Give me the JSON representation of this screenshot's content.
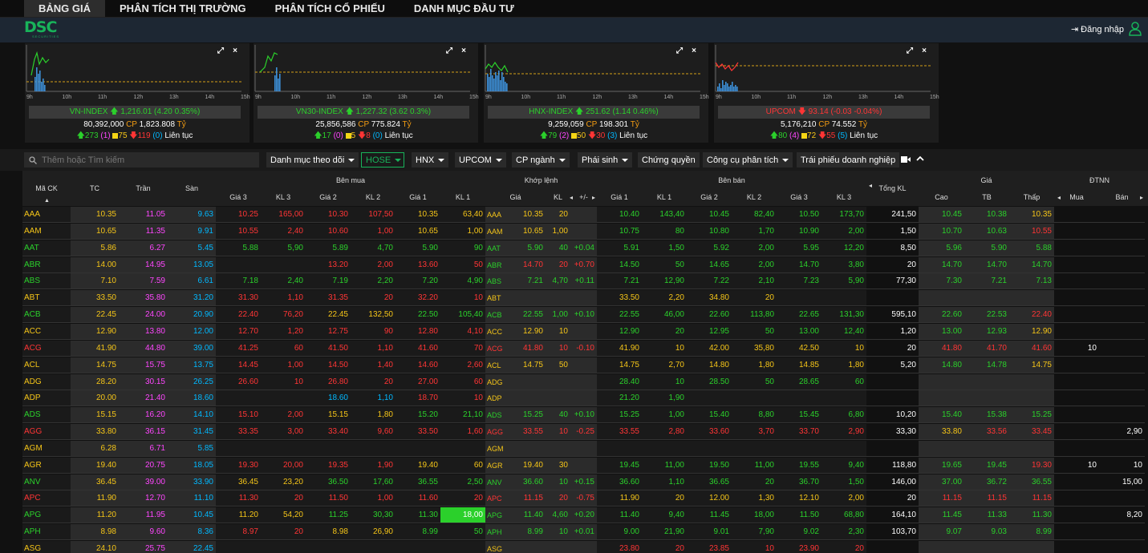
{
  "nav": {
    "tabs": [
      "BẢNG GIÁ",
      "PHÂN TÍCH THỊ TRƯỜNG",
      "PHÂN TÍCH CỔ PHIẾU",
      "DANH MỤC ĐẦU TƯ"
    ],
    "active": 0
  },
  "header": {
    "logo": "DSC",
    "logo_sub": "SECURITIES",
    "login_label": "Đăng nhập"
  },
  "indices": [
    {
      "name": "VN-INDEX",
      "value": "1,216.01",
      "change": "(4.20 0.35%)",
      "dir": "up",
      "volume": "80,392,000",
      "cp_label": "CP",
      "value_traded": "1,823.808",
      "unit": "Tỷ",
      "adv": "273",
      "ceil": "(1)",
      "unch": "75",
      "dec": "119",
      "floor": "(0)",
      "session": "Liên tục"
    },
    {
      "name": "VN30-INDEX",
      "value": "1,227.32",
      "change": "(3.62 0.3%)",
      "dir": "up",
      "volume": "25,856,586",
      "cp_label": "CP",
      "value_traded": "775.824",
      "unit": "Tỷ",
      "adv": "17",
      "ceil": "(0)",
      "unch": "5",
      "dec": "8",
      "floor": "(0)",
      "session": "Liên tục"
    },
    {
      "name": "HNX-INDEX",
      "value": "251.62",
      "change": "(1.14 0.46%)",
      "dir": "up",
      "volume": "9,259,059",
      "cp_label": "CP",
      "value_traded": "198.301",
      "unit": "Tỷ",
      "adv": "79",
      "ceil": "(2)",
      "unch": "50",
      "dec": "30",
      "floor": "(3)",
      "session": "Liên tục"
    },
    {
      "name": "UPCOM",
      "value": "93.14",
      "change": "(-0.03 -0.04%)",
      "dir": "down",
      "volume": "5,176,210",
      "cp_label": "CP",
      "value_traded": "74.552",
      "unit": "Tỷ",
      "adv": "80",
      "ceil": "(4)",
      "unch": "72",
      "dec": "55",
      "floor": "(5)",
      "session": "Liên tục"
    }
  ],
  "chart_ticks": [
    "9h",
    "10h",
    "11h",
    "12h",
    "13h",
    "14h",
    "15h"
  ],
  "filters": {
    "search_placeholder": "Thêm hoặc Tìm kiếm",
    "buttons": [
      "Danh mục theo dõi",
      "HOSE",
      "HNX",
      "UPCOM",
      "CP ngành",
      "Phái sinh",
      "Chứng quyền",
      "Công cụ phân tích",
      "Trái phiếu doanh nghiệp"
    ]
  },
  "table_headers": {
    "groups": [
      "Bên mua",
      "Khớp lệnh",
      "Bên bán",
      "Giá",
      "ĐTNN"
    ],
    "ma_ck": "Mã CK",
    "tc": "TC",
    "tran": "Trần",
    "san": "Sàn",
    "tong_kl": "Tổng KL",
    "buy": [
      "Giá 3",
      "KL 3",
      "Giá 2",
      "KL 2",
      "Giá 1",
      "KL 1"
    ],
    "match": [
      "Giá",
      "KL",
      "+/-"
    ],
    "sell": [
      "Giá 1",
      "KL 1",
      "Giá 2",
      "KL 2",
      "Giá 3",
      "KL 3"
    ],
    "price": [
      "Cao",
      "TB",
      "Thấp"
    ],
    "foreign": [
      "Mua",
      "Bán"
    ]
  },
  "rows": [
    {
      "sym": "AAA",
      "c": "y",
      "tc": "10.35",
      "tr": "11.05",
      "sa": "9.63",
      "b3": "10.25",
      "k3": "165,00",
      "b2": "10.30",
      "k2": "107,50",
      "b1": "10.35",
      "k1": "63,40",
      "cb": "y",
      "mp": "10.35",
      "mk": "20",
      "mc": "",
      "s1": "10.40",
      "s1k": "143,40",
      "s2": "10.45",
      "s2k": "82,40",
      "s3": "10.50",
      "s3k": "173,70",
      "tkl": "241,50",
      "hi": "10.45",
      "tb": "10.38",
      "lo": "10.35",
      "fb": "",
      "fs": "",
      "sc": "g",
      "hc": "g",
      "lc": "y",
      "b3c": "r",
      "b2c": "r",
      "b1c": "y"
    },
    {
      "sym": "AAM",
      "c": "y",
      "tc": "10.65",
      "tr": "11.35",
      "sa": "9.91",
      "b3": "10.55",
      "k3": "2,40",
      "b2": "10.60",
      "k2": "1,00",
      "b1": "10.65",
      "k1": "1,00",
      "cb": "y",
      "mp": "10.65",
      "mk": "1,00",
      "mc": "",
      "s1": "10.75",
      "s1k": "80",
      "s2": "10.80",
      "s2k": "1,70",
      "s3": "10.90",
      "s3k": "2,00",
      "tkl": "1,50",
      "hi": "10.70",
      "tb": "10.63",
      "lo": "10.55",
      "fb": "",
      "fs": "",
      "sc": "g",
      "hc": "g",
      "lc": "r",
      "b3c": "r",
      "b2c": "r",
      "b1c": "y"
    },
    {
      "sym": "AAT",
      "c": "g",
      "tc": "5.86",
      "tr": "6.27",
      "sa": "5.45",
      "b3": "5.88",
      "k3": "5,90",
      "b2": "5.89",
      "k2": "4,70",
      "b1": "5.90",
      "k1": "90",
      "cb": "g",
      "mp": "5.90",
      "mk": "40",
      "mc": "+0.04",
      "s1": "5.91",
      "s1k": "1,50",
      "s2": "5.92",
      "s2k": "2,00",
      "s3": "5.95",
      "s3k": "12,20",
      "tkl": "8,50",
      "hi": "5.96",
      "tb": "5.90",
      "lo": "5.88",
      "fb": "",
      "fs": "",
      "sc": "g",
      "hc": "g",
      "lc": "g",
      "b3c": "g",
      "b2c": "g",
      "b1c": "g"
    },
    {
      "sym": "ABR",
      "c": "g",
      "tc": "14.00",
      "tr": "14.95",
      "sa": "13.05",
      "b3": "",
      "k3": "",
      "b2": "13.20",
      "k2": "2,00",
      "b1": "13.60",
      "k1": "50",
      "cb": "r",
      "mp": "14.70",
      "mk": "20",
      "mc": "+0.70",
      "s1": "14.50",
      "s1k": "50",
      "s2": "14.65",
      "s2k": "2,00",
      "s3": "14.70",
      "s3k": "3,80",
      "tkl": "20",
      "hi": "14.70",
      "tb": "14.70",
      "lo": "14.70",
      "fb": "",
      "fs": "",
      "sc": "g",
      "hc": "g",
      "lc": "g",
      "b3c": "r",
      "b2c": "r",
      "b1c": "r"
    },
    {
      "sym": "ABS",
      "c": "g",
      "tc": "7.10",
      "tr": "7.59",
      "sa": "6.61",
      "b3": "7.18",
      "k3": "2,40",
      "b2": "7.19",
      "k2": "2,20",
      "b1": "7.20",
      "k1": "4,90",
      "cb": "g",
      "mp": "7.21",
      "mk": "4,70",
      "mc": "+0.11",
      "s1": "7.21",
      "s1k": "12,90",
      "s2": "7.22",
      "s2k": "2,10",
      "s3": "7.23",
      "s3k": "5,90",
      "tkl": "77,30",
      "hi": "7.30",
      "tb": "7.21",
      "lo": "7.13",
      "fb": "",
      "fs": "",
      "sc": "g",
      "hc": "g",
      "lc": "g",
      "b3c": "g",
      "b2c": "g",
      "b1c": "g"
    },
    {
      "sym": "ABT",
      "c": "y",
      "tc": "33.50",
      "tr": "35.80",
      "sa": "31.20",
      "b3": "31.30",
      "k3": "1,10",
      "b2": "31.35",
      "k2": "20",
      "b1": "32.20",
      "k1": "10",
      "cb": "y",
      "mp": "",
      "mk": "",
      "mc": "",
      "s1": "33.50",
      "s1k": "2,20",
      "s2": "34.80",
      "s2k": "20",
      "s3": "",
      "s3k": "",
      "tkl": "",
      "hi": "",
      "tb": "",
      "lo": "",
      "fb": "",
      "fs": "",
      "sc": "y",
      "hc": "g",
      "lc": "g",
      "b3c": "r",
      "b2c": "r",
      "b1c": "r"
    },
    {
      "sym": "ACB",
      "c": "g",
      "tc": "22.45",
      "tr": "24.00",
      "sa": "20.90",
      "b3": "22.40",
      "k3": "76,20",
      "b2": "22.45",
      "k2": "132,50",
      "b1": "22.50",
      "k1": "105,40",
      "cb": "g",
      "mp": "22.55",
      "mk": "1,00",
      "mc": "+0.10",
      "s1": "22.55",
      "s1k": "46,00",
      "s2": "22.60",
      "s2k": "113,80",
      "s3": "22.65",
      "s3k": "131,30",
      "tkl": "595,10",
      "hi": "22.60",
      "tb": "22.53",
      "lo": "22.40",
      "fb": "",
      "fs": "",
      "sc": "g",
      "hc": "g",
      "lc": "r",
      "b3c": "r",
      "b2c": "y",
      "b1c": "g"
    },
    {
      "sym": "ACC",
      "c": "y",
      "tc": "12.90",
      "tr": "13.80",
      "sa": "12.00",
      "b3": "12.70",
      "k3": "1,20",
      "b2": "12.75",
      "k2": "90",
      "b1": "12.80",
      "k1": "4,10",
      "cb": "y",
      "mp": "12.90",
      "mk": "10",
      "mc": "",
      "s1": "12.90",
      "s1k": "20",
      "s2": "12.95",
      "s2k": "50",
      "s3": "13.00",
      "s3k": "12,40",
      "tkl": "1,20",
      "hi": "13.00",
      "tb": "12.93",
      "lo": "12.90",
      "fb": "",
      "fs": "",
      "sc": "g",
      "hc": "g",
      "lc": "y",
      "b3c": "r",
      "b2c": "r",
      "b1c": "r"
    },
    {
      "sym": "ACG",
      "c": "r",
      "tc": "41.90",
      "tr": "44.80",
      "sa": "39.00",
      "b3": "41.25",
      "k3": "60",
      "b2": "41.50",
      "k2": "1,10",
      "b1": "41.60",
      "k1": "70",
      "cb": "r",
      "mp": "41.80",
      "mk": "10",
      "mc": "-0.10",
      "s1": "41.90",
      "s1k": "10",
      "s2": "42.00",
      "s2k": "35,80",
      "s3": "42.50",
      "s3k": "10",
      "tkl": "20",
      "hi": "41.80",
      "tb": "41.70",
      "lo": "41.60",
      "fb": "10",
      "fs": "",
      "sc": "y",
      "hc": "r",
      "lc": "r",
      "b3c": "r",
      "b2c": "r",
      "b1c": "r"
    },
    {
      "sym": "ACL",
      "c": "y",
      "tc": "14.75",
      "tr": "15.75",
      "sa": "13.75",
      "b3": "14.45",
      "k3": "1,00",
      "b2": "14.50",
      "k2": "1,40",
      "b1": "14.60",
      "k1": "2,60",
      "cb": "y",
      "mp": "14.75",
      "mk": "50",
      "mc": "",
      "s1": "14.75",
      "s1k": "2,70",
      "s2": "14.80",
      "s2k": "1,80",
      "s3": "14.85",
      "s3k": "1,80",
      "tkl": "5,20",
      "hi": "14.80",
      "tb": "14.78",
      "lo": "14.75",
      "fb": "",
      "fs": "",
      "sc": "y",
      "hc": "g",
      "lc": "y",
      "b3c": "r",
      "b2c": "r",
      "b1c": "r"
    },
    {
      "sym": "ADG",
      "c": "y",
      "tc": "28.20",
      "tr": "30.15",
      "sa": "26.25",
      "b3": "26.60",
      "k3": "10",
      "b2": "26.80",
      "k2": "20",
      "b1": "27.00",
      "k1": "60",
      "cb": "y",
      "mp": "",
      "mk": "",
      "mc": "",
      "s1": "28.40",
      "s1k": "10",
      "s2": "28.50",
      "s2k": "50",
      "s3": "28.65",
      "s3k": "60",
      "tkl": "",
      "hi": "",
      "tb": "",
      "lo": "",
      "fb": "",
      "fs": "",
      "sc": "g",
      "hc": "g",
      "lc": "g",
      "b3c": "r",
      "b2c": "r",
      "b1c": "r"
    },
    {
      "sym": "ADP",
      "c": "y",
      "tc": "20.00",
      "tr": "21.40",
      "sa": "18.60",
      "b3": "",
      "k3": "",
      "b2": "18.60",
      "k2": "1,10",
      "b1": "18.70",
      "k1": "10",
      "cb": "y",
      "mp": "",
      "mk": "",
      "mc": "",
      "s1": "21.20",
      "s1k": "1,90",
      "s2": "",
      "s2k": "",
      "s3": "",
      "s3k": "",
      "tkl": "",
      "hi": "",
      "tb": "",
      "lo": "",
      "fb": "",
      "fs": "",
      "sc": "g",
      "hc": "g",
      "lc": "g",
      "b3c": "r",
      "b2c": "c",
      "b1c": "r"
    },
    {
      "sym": "ADS",
      "c": "g",
      "tc": "15.15",
      "tr": "16.20",
      "sa": "14.10",
      "b3": "15.10",
      "k3": "2,00",
      "b2": "15.15",
      "k2": "1,80",
      "b1": "15.20",
      "k1": "21,10",
      "cb": "g",
      "mp": "15.25",
      "mk": "40",
      "mc": "+0.10",
      "s1": "15.25",
      "s1k": "1,00",
      "s2": "15.40",
      "s2k": "8,80",
      "s3": "15.45",
      "s3k": "6,80",
      "tkl": "10,20",
      "hi": "15.40",
      "tb": "15.38",
      "lo": "15.25",
      "fb": "",
      "fs": "",
      "sc": "g",
      "hc": "g",
      "lc": "g",
      "b3c": "r",
      "b2c": "y",
      "b1c": "g"
    },
    {
      "sym": "AGG",
      "c": "r",
      "tc": "33.80",
      "tr": "36.15",
      "sa": "31.45",
      "b3": "33.35",
      "k3": "3,00",
      "b2": "33.40",
      "k2": "9,60",
      "b1": "33.50",
      "k1": "1,60",
      "cb": "r",
      "mp": "33.55",
      "mk": "10",
      "mc": "-0.25",
      "s1": "33.55",
      "s1k": "2,80",
      "s2": "33.60",
      "s2k": "3,70",
      "s3": "33.70",
      "s3k": "2,90",
      "tkl": "33,30",
      "hi": "33.80",
      "tb": "33.56",
      "lo": "33.45",
      "fb": "",
      "fs": "2,90",
      "sc": "r",
      "hc": "y",
      "lc": "r",
      "b3c": "r",
      "b2c": "r",
      "b1c": "r"
    },
    {
      "sym": "AGM",
      "c": "y",
      "tc": "6.28",
      "tr": "6.71",
      "sa": "5.85",
      "b3": "",
      "k3": "",
      "b2": "",
      "k2": "",
      "b1": "",
      "k1": "",
      "cb": "y",
      "mp": "",
      "mk": "",
      "mc": "",
      "s1": "",
      "s1k": "",
      "s2": "",
      "s2k": "",
      "s3": "",
      "s3k": "",
      "tkl": "",
      "hi": "",
      "tb": "",
      "lo": "",
      "fb": "",
      "fs": "",
      "sc": "g",
      "hc": "g",
      "lc": "g",
      "b3c": "r",
      "b2c": "r",
      "b1c": "r"
    },
    {
      "sym": "AGR",
      "c": "y",
      "tc": "19.40",
      "tr": "20.75",
      "sa": "18.05",
      "b3": "19.30",
      "k3": "20,00",
      "b2": "19.35",
      "k2": "1,90",
      "b1": "19.40",
      "k1": "60",
      "cb": "y",
      "mp": "19.40",
      "mk": "30",
      "mc": "",
      "s1": "19.45",
      "s1k": "11,00",
      "s2": "19.50",
      "s2k": "11,00",
      "s3": "19.55",
      "s3k": "9,40",
      "tkl": "118,80",
      "hi": "19.65",
      "tb": "19.45",
      "lo": "19.30",
      "fb": "10",
      "fs": "10",
      "sc": "g",
      "hc": "g",
      "lc": "r",
      "b3c": "r",
      "b2c": "r",
      "b1c": "y"
    },
    {
      "sym": "ANV",
      "c": "g",
      "tc": "36.45",
      "tr": "39.00",
      "sa": "33.90",
      "b3": "36.45",
      "k3": "23,20",
      "b2": "36.50",
      "k2": "17,60",
      "b1": "36.55",
      "k1": "2,50",
      "cb": "g",
      "mp": "36.60",
      "mk": "10",
      "mc": "+0.15",
      "s1": "36.60",
      "s1k": "1,10",
      "s2": "36.65",
      "s2k": "20",
      "s3": "36.70",
      "s3k": "1,50",
      "tkl": "146,00",
      "hi": "37.00",
      "tb": "36.72",
      "lo": "36.55",
      "fb": "",
      "fs": "15,00",
      "sc": "g",
      "hc": "g",
      "lc": "g",
      "b3c": "y",
      "b2c": "g",
      "b1c": "g"
    },
    {
      "sym": "APC",
      "c": "r",
      "tc": "11.90",
      "tr": "12.70",
      "sa": "11.10",
      "b3": "11.30",
      "k3": "20",
      "b2": "11.50",
      "k2": "1,00",
      "b1": "11.60",
      "k1": "20",
      "cb": "r",
      "mp": "11.15",
      "mk": "20",
      "mc": "-0.75",
      "s1": "11.90",
      "s1k": "20",
      "s2": "12.00",
      "s2k": "1,30",
      "s3": "12.10",
      "s3k": "2,00",
      "tkl": "20",
      "hi": "11.15",
      "tb": "11.15",
      "lo": "11.15",
      "fb": "",
      "fs": "",
      "sc": "y",
      "hc": "r",
      "lc": "r",
      "b3c": "r",
      "b2c": "r",
      "b1c": "r"
    },
    {
      "sym": "APG",
      "c": "g",
      "tc": "11.20",
      "tr": "11.95",
      "sa": "10.45",
      "b3": "11.20",
      "k3": "54,20",
      "b2": "11.25",
      "k2": "30,30",
      "b1": "11.30",
      "k1": "18,00",
      "cb": "g",
      "mp": "11.40",
      "mk": "4,60",
      "mc": "+0.20",
      "s1": "11.40",
      "s1k": "9,40",
      "s2": "11.45",
      "s2k": "18,00",
      "s3": "11.50",
      "s3k": "68,80",
      "tkl": "164,10",
      "hi": "11.45",
      "tb": "11.33",
      "lo": "11.30",
      "fb": "",
      "fs": "8,20",
      "sc": "g",
      "hc": "g",
      "lc": "g",
      "b3c": "y",
      "b2c": "g",
      "b1c": "g",
      "hl": true
    },
    {
      "sym": "APH",
      "c": "g",
      "tc": "8.98",
      "tr": "9.60",
      "sa": "8.36",
      "b3": "8.97",
      "k3": "20",
      "b2": "8.98",
      "k2": "26,90",
      "b1": "8.99",
      "k1": "50",
      "cb": "g",
      "mp": "8.99",
      "mk": "10",
      "mc": "+0.01",
      "s1": "9.00",
      "s1k": "21,90",
      "s2": "9.01",
      "s2k": "7,90",
      "s3": "9.02",
      "s3k": "2,30",
      "tkl": "103,70",
      "hi": "9.07",
      "tb": "9.03",
      "lo": "8.99",
      "fb": "",
      "fs": "",
      "sc": "g",
      "hc": "g",
      "lc": "g",
      "b3c": "r",
      "b2c": "y",
      "b1c": "g"
    },
    {
      "sym": "ASG",
      "c": "y",
      "tc": "24.10",
      "tr": "25.75",
      "sa": "22.45",
      "b3": "",
      "k3": "",
      "b2": "",
      "k2": "",
      "b1": "",
      "k1": "",
      "cb": "y",
      "mp": "",
      "mk": "",
      "mc": "",
      "s1": "23.80",
      "s1k": "20",
      "s2": "23.85",
      "s2k": "10",
      "s3": "23.90",
      "s3k": "20",
      "tkl": "",
      "hi": "",
      "tb": "",
      "lo": "",
      "fb": "",
      "fs": "",
      "sc": "r",
      "hc": "g",
      "lc": "g",
      "b3c": "r",
      "b2c": "r",
      "b1c": "r"
    }
  ]
}
